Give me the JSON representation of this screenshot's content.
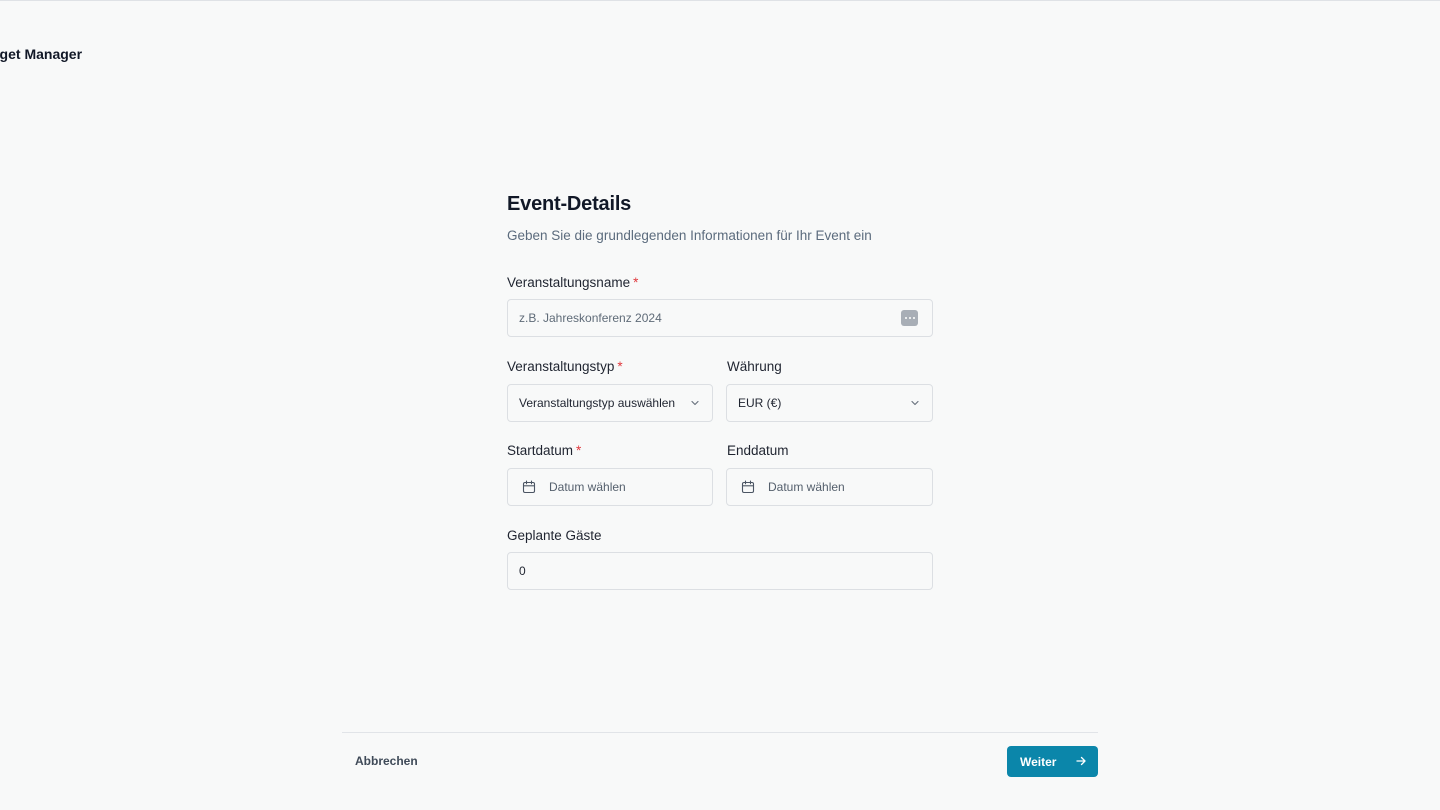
{
  "app": {
    "title": "dget Manager"
  },
  "form": {
    "title": "Event-Details",
    "subtitle": "Geben Sie die grundlegenden Informationen für Ihr Event ein",
    "required_marker": "*",
    "event_name": {
      "label": "Veranstaltungsname",
      "placeholder": "z.B. Jahreskonferenz 2024",
      "value": "",
      "required": true
    },
    "event_type": {
      "label": "Veranstaltungstyp",
      "selected": "Veranstaltungstyp auswählen",
      "required": true
    },
    "currency": {
      "label": "Währung",
      "selected": "EUR (€)"
    },
    "start_date": {
      "label": "Startdatum",
      "placeholder": "Datum wählen",
      "required": true
    },
    "end_date": {
      "label": "Enddatum",
      "placeholder": "Datum wählen"
    },
    "guests": {
      "label": "Geplante Gäste",
      "value": "0"
    }
  },
  "footer": {
    "cancel_label": "Abbrechen",
    "next_label": "Weiter"
  },
  "colors": {
    "accent": "#0b86aa",
    "required": "#e0393e",
    "background": "#f8f9f9"
  },
  "icons": [
    "more-dots-icon",
    "chevron-down-icon",
    "calendar-icon",
    "arrow-right-icon"
  ]
}
